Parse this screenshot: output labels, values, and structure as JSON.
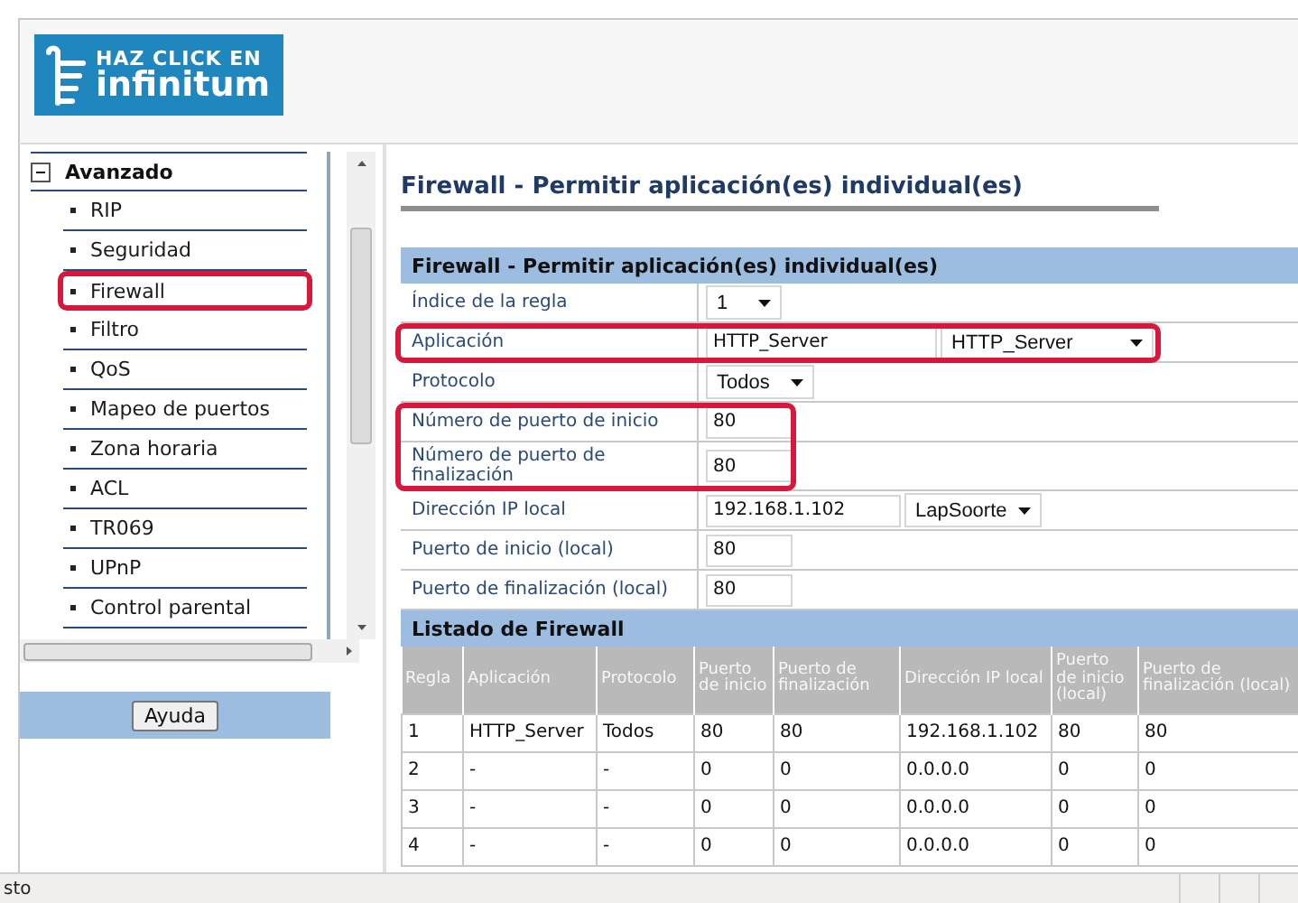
{
  "logo": {
    "line_1": "HAZ CLICK EN",
    "line_2": "infinitum"
  },
  "sidebar": {
    "group": {
      "label": "Avanzado",
      "expanded": true
    },
    "items": [
      {
        "label": "RIP",
        "highlighted": false
      },
      {
        "label": "Seguridad",
        "highlighted": false
      },
      {
        "label": "Firewall",
        "highlighted": true
      },
      {
        "label": "Filtro",
        "highlighted": false
      },
      {
        "label": "QoS",
        "highlighted": false
      },
      {
        "label": "Mapeo de puertos",
        "highlighted": false
      },
      {
        "label": "Zona horaria",
        "highlighted": false
      },
      {
        "label": "ACL",
        "highlighted": false
      },
      {
        "label": "TR069",
        "highlighted": false
      },
      {
        "label": "UPnP",
        "highlighted": false
      },
      {
        "label": "Control parental",
        "highlighted": false
      }
    ],
    "help_button": "Ayuda"
  },
  "page_title": "Firewall - Permitir aplicación(es) individual(es)",
  "form": {
    "title": "Firewall - Permitir aplicación(es) individual(es)",
    "groups": [
      {
        "highlighted": false,
        "rows": [
          {
            "label": "Índice de la regla",
            "kind": "select",
            "select": "1"
          }
        ]
      },
      {
        "highlighted": true,
        "rows": [
          {
            "label": "Aplicación",
            "kind": "text_select",
            "value": "HTTP_Server",
            "select": "HTTP_Server"
          }
        ]
      },
      {
        "highlighted": false,
        "rows": [
          {
            "label": "Protocolo",
            "kind": "select",
            "select": "Todos"
          }
        ]
      },
      {
        "highlighted": true,
        "rows": [
          {
            "label": "Número de puerto de inicio",
            "kind": "text",
            "value": "80"
          },
          {
            "label": "Número de puerto de finalización",
            "kind": "text",
            "value": "80"
          }
        ]
      },
      {
        "highlighted": false,
        "rows": [
          {
            "label": "Dirección IP local",
            "kind": "text_select",
            "value": "192.168.1.102",
            "select": "LapSoorte"
          },
          {
            "label": "Puerto de inicio (local)",
            "kind": "text",
            "value": "80"
          },
          {
            "label": "Puerto de finalización (local)",
            "kind": "text",
            "value": "80"
          }
        ]
      }
    ]
  },
  "listing": {
    "title": "Listado de Firewall",
    "columns": [
      "Regla",
      "Aplicación",
      "Protocolo",
      "Puerto de inicio",
      "Puerto de finalización",
      "Dirección IP local",
      "Puerto de inicio (local)",
      "Puerto de finalización (local)"
    ],
    "rows": [
      [
        "1",
        "HTTP_Server",
        "Todos",
        "80",
        "80",
        "192.168.1.102",
        "80",
        "80"
      ],
      [
        "2",
        "-",
        "-",
        "0",
        "0",
        "0.0.0.0",
        "0",
        "0"
      ],
      [
        "3",
        "-",
        "-",
        "0",
        "0",
        "0.0.0.0",
        "0",
        "0"
      ],
      [
        "4",
        "-",
        "-",
        "0",
        "0",
        "0.0.0.0",
        "0",
        "0"
      ]
    ]
  },
  "status_bar": "sto"
}
